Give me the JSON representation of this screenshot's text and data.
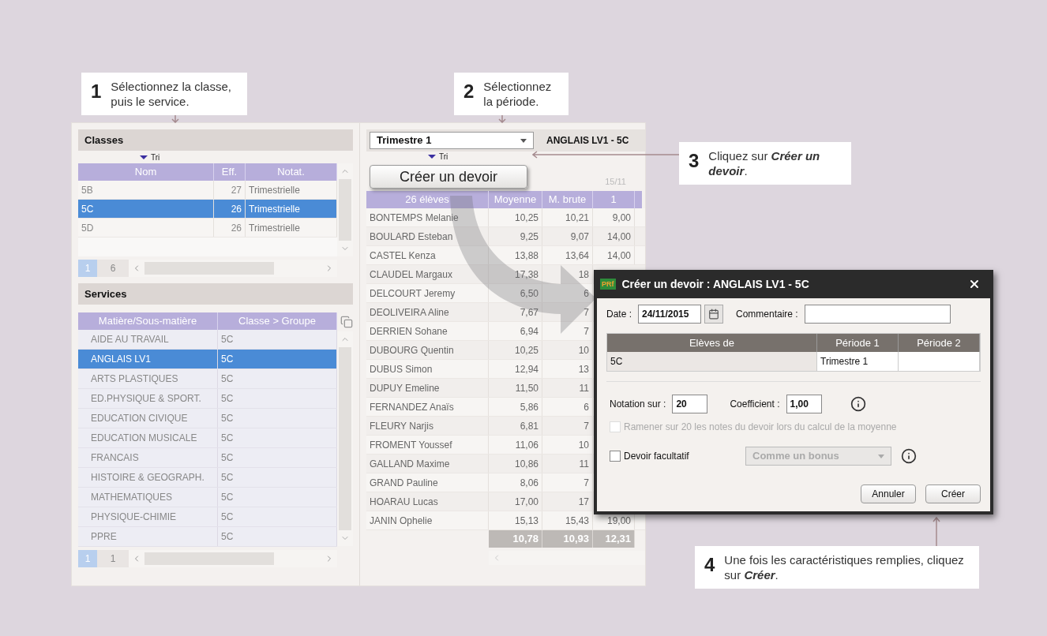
{
  "callouts": [
    {
      "number": "1",
      "text": "Sélectionnez la classe, puis le service."
    },
    {
      "number": "2",
      "text": "Sélectionnez la période."
    },
    {
      "number": "3",
      "text": "Cliquez sur **Créer un devoir**."
    },
    {
      "number": "4",
      "text": "Une fois les caractéristiques remplies, cliquez sur **Créer**."
    }
  ],
  "classes": {
    "title": "Classes",
    "sort_label": "Tri",
    "columns": [
      "Nom",
      "Eff.",
      "Notat."
    ],
    "rows": [
      {
        "cells": [
          "5B",
          "27",
          "Trimestrielle"
        ],
        "selected": false
      },
      {
        "cells": [
          "5C",
          "26",
          "Trimestrielle"
        ],
        "selected": true
      },
      {
        "cells": [
          "5D",
          "26",
          "Trimestrielle"
        ],
        "selected": false
      }
    ],
    "pager": [
      "1",
      "6"
    ]
  },
  "services": {
    "title": "Services",
    "columns": [
      "Matière/Sous-matière",
      "Classe > Groupe"
    ],
    "rows": [
      {
        "cells": [
          "AIDE AU TRAVAIL",
          "5C"
        ],
        "selected": false
      },
      {
        "cells": [
          "ANGLAIS LV1",
          "5C"
        ],
        "selected": true
      },
      {
        "cells": [
          "ARTS PLASTIQUES",
          "5C"
        ],
        "selected": false
      },
      {
        "cells": [
          "ED.PHYSIQUE & SPORT.",
          "5C"
        ],
        "selected": false
      },
      {
        "cells": [
          "EDUCATION CIVIQUE",
          "5C"
        ],
        "selected": false
      },
      {
        "cells": [
          "EDUCATION MUSICALE",
          "5C"
        ],
        "selected": false
      },
      {
        "cells": [
          "FRANCAIS",
          "5C"
        ],
        "selected": false
      },
      {
        "cells": [
          "HISTOIRE & GEOGRAPH.",
          "5C"
        ],
        "selected": false
      },
      {
        "cells": [
          "MATHEMATIQUES",
          "5C"
        ],
        "selected": false
      },
      {
        "cells": [
          "PHYSIQUE-CHIMIE",
          "5C"
        ],
        "selected": false
      },
      {
        "cells": [
          "PPRE",
          "5C"
        ],
        "selected": false
      }
    ],
    "pager": [
      "1",
      "1"
    ]
  },
  "period_select": {
    "value": "Trimestre 1"
  },
  "service_title": "ANGLAIS LV1 - 5C",
  "sort_label": "Tri",
  "create_button": "Créer un devoir",
  "date_header": "15/11",
  "grades": {
    "columns": [
      "26 élèves",
      "Moyenne",
      "M. brute",
      "1"
    ],
    "rows": [
      {
        "cells": [
          "BONTEMPS Melanie",
          "10,25",
          "10,21",
          "9,00"
        ]
      },
      {
        "cells": [
          "BOULARD Esteban",
          "9,25",
          "9,07",
          "14,00"
        ]
      },
      {
        "cells": [
          "CASTEL Kenza",
          "13,88",
          "13,64",
          "14,00"
        ]
      },
      {
        "cells": [
          "CLAUDEL Margaux",
          "17,38",
          "18"
        ]
      },
      {
        "cells": [
          "DELCOURT Jeremy",
          "6,50",
          "6"
        ]
      },
      {
        "cells": [
          "DEOLIVEIRA Aline",
          "7,67",
          "7"
        ]
      },
      {
        "cells": [
          "DERRIEN Sohane",
          "6,94",
          "7"
        ]
      },
      {
        "cells": [
          "DUBOURG Quentin",
          "10,25",
          "10"
        ]
      },
      {
        "cells": [
          "DUBUS Simon",
          "12,94",
          "13"
        ]
      },
      {
        "cells": [
          "DUPUY Emeline",
          "11,50",
          "11"
        ]
      },
      {
        "cells": [
          "FERNANDEZ Anaïs",
          "5,86",
          "6"
        ]
      },
      {
        "cells": [
          "FLEURY Narjis",
          "6,81",
          "7"
        ]
      },
      {
        "cells": [
          "FROMENT Youssef",
          "11,06",
          "10"
        ]
      },
      {
        "cells": [
          "GALLAND Maxime",
          "10,86",
          "11"
        ]
      },
      {
        "cells": [
          "GRAND Pauline",
          "8,06",
          "7"
        ]
      },
      {
        "cells": [
          "HOARAU Lucas",
          "17,00",
          "17"
        ]
      },
      {
        "cells": [
          "JANIN Ophelie",
          "15,13",
          "15,43",
          "19,00"
        ]
      }
    ],
    "totals": [
      "10,78",
      "10,93",
      "12,31"
    ]
  },
  "dialog": {
    "logo_text": "PRf",
    "title": "Créer un devoir : ANGLAIS LV1 - 5C",
    "date_label": "Date :",
    "date_value": "24/11/2015",
    "comment_label": "Commentaire :",
    "table": {
      "columns": [
        "Elèves de",
        "Période 1",
        "Période 2"
      ],
      "rows": [
        [
          "5C",
          "Trimestre 1"
        ]
      ]
    },
    "notation_label": "Notation sur :",
    "notation_value": "20",
    "coefficient_label": "Coefficient :",
    "coefficient_value": "1,00",
    "rescale_option": {
      "label": "Ramener sur 20 les notes du devoir lors du calcul de la moyenne",
      "checked": false,
      "disabled": true
    },
    "optional_option": {
      "label": "Devoir facultatif",
      "checked": false,
      "disabled": false
    },
    "bonus_select": {
      "value": "Comme un bonus",
      "disabled": true
    },
    "buttons": [
      "Annuler",
      "Créer"
    ]
  }
}
